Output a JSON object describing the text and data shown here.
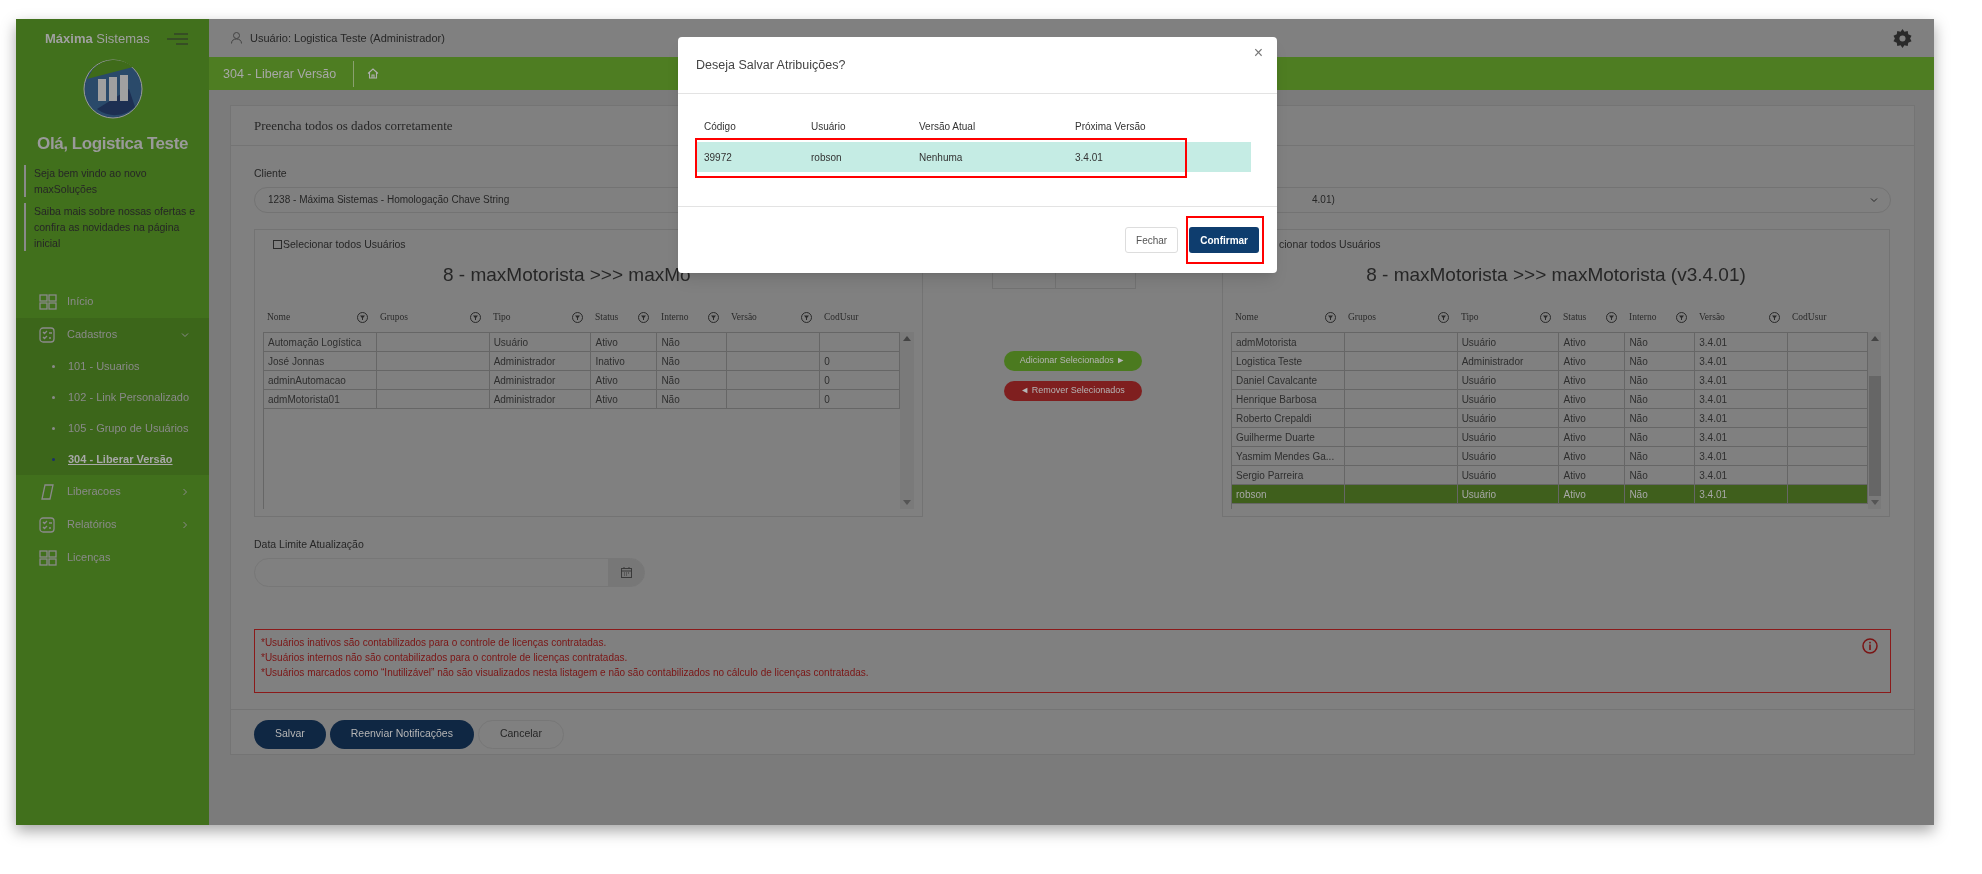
{
  "sidebar": {
    "brand": "**Máxima** Sistemas",
    "greeting": "Olá, Logistica Teste",
    "notes": [
      "Seja bem vindo ao novo maxSoluções",
      "Saiba mais sobre nossas ofertas e confira as novidades na página inicial"
    ],
    "menu": [
      {
        "kind": "link",
        "label": "Início"
      },
      {
        "kind": "group",
        "label": "Cadastros",
        "expanded": true,
        "children": [
          {
            "label": "101 - Usuarios",
            "selected": false
          },
          {
            "label": "102 - Link Personalizado",
            "selected": false
          },
          {
            "label": "105 - Grupo de Usuários",
            "selected": false
          },
          {
            "label": "304 - Liberar Versão",
            "selected": true
          }
        ]
      },
      {
        "kind": "group",
        "label": "Liberacoes",
        "expanded": false
      },
      {
        "kind": "group",
        "label": "Relatórios",
        "expanded": false
      },
      {
        "kind": "link",
        "label": "Licenças"
      }
    ]
  },
  "header": {
    "user": "Usuário: Logistica Teste (Administrador)"
  },
  "breadcrumb": "304 - Liberar Versão",
  "form": {
    "title": "Preencha todos os dados corretamente",
    "client_label": "Cliente",
    "client_value": "1238 - Máxima Sistemas - Homologação Chave String",
    "version_value": "4.01)",
    "left_panel": {
      "select_all": "Selecionar todos Usuários",
      "select_all_checked": false,
      "title": "8 - maxMotorista >>> maxMo",
      "columns": [
        "Nome",
        "Grupos",
        "Tipo",
        "Status",
        "Interno",
        "Versão",
        "CodUsur"
      ],
      "rows": [
        {
          "nome": "Automação Logística",
          "tipo": "Usuário",
          "status": "Ativo",
          "interno": "Não"
        },
        {
          "nome": "José Jonnas",
          "tipo": "Administrador",
          "status": "Inativo",
          "interno": "Não",
          "codusur": "0"
        },
        {
          "nome": "adminAutomacao",
          "tipo": "Administrador",
          "status": "Ativo",
          "interno": "Não",
          "codusur": "0"
        },
        {
          "nome": "admMotorista01",
          "tipo": "Administrador",
          "status": "Ativo",
          "interno": "Não",
          "codusur": "0"
        }
      ]
    },
    "middle": {
      "add": "Adicionar Selecionados ►",
      "remove": "◄ Remover Selecionados"
    },
    "right_panel": {
      "select_all": "cionar todos Usuários",
      "title": "8 - maxMotorista >>> maxMotorista (v3.4.01)",
      "columns": [
        "Nome",
        "Grupos",
        "Tipo",
        "Status",
        "Interno",
        "Versão",
        "CodUsur"
      ],
      "rows": [
        {
          "nome": "admMotorista",
          "tipo": "Usuário",
          "status": "Ativo",
          "interno": "Não",
          "versao": "3.4.01",
          "selected": false
        },
        {
          "nome": "Logistica Teste",
          "tipo": "Administrador",
          "status": "Ativo",
          "interno": "Não",
          "versao": "3.4.01",
          "selected": false
        },
        {
          "nome": "Daniel Cavalcante",
          "tipo": "Usuário",
          "status": "Ativo",
          "interno": "Não",
          "versao": "3.4.01",
          "selected": false
        },
        {
          "nome": "Henrique Barbosa",
          "tipo": "Usuário",
          "status": "Ativo",
          "interno": "Não",
          "versao": "3.4.01",
          "selected": false
        },
        {
          "nome": "Roberto Crepaldi",
          "tipo": "Usuário",
          "status": "Ativo",
          "interno": "Não",
          "versao": "3.4.01",
          "selected": false
        },
        {
          "nome": "Guilherme Duarte",
          "tipo": "Usuário",
          "status": "Ativo",
          "interno": "Não",
          "versao": "3.4.01",
          "selected": false
        },
        {
          "nome": "Yasmim Mendes Ga...",
          "tipo": "Usuário",
          "status": "Ativo",
          "interno": "Não",
          "versao": "3.4.01",
          "selected": false
        },
        {
          "nome": "Sergio Parreira",
          "tipo": "Usuário",
          "status": "Ativo",
          "interno": "Não",
          "versao": "3.4.01",
          "selected": false
        },
        {
          "nome": "robson",
          "tipo": "Usuário",
          "status": "Ativo",
          "interno": "Não",
          "versao": "3.4.01",
          "selected": true
        }
      ]
    },
    "date_label": "Data Limite Atualização",
    "notices": [
      "*Usuários inativos são contabilizados para o controle de licenças contratadas.",
      "*Usuários internos não são contabilizados para o controle de licenças contratadas.",
      "*Usuários marcados como “Inutilizável” não são visualizados nesta listagem e não são contabilizados no cálculo de licenças contratadas."
    ],
    "buttons": [
      {
        "kind": "primary",
        "label": "Salvar"
      },
      {
        "kind": "primary",
        "label": "Reenviar Notificações"
      },
      {
        "kind": "outline",
        "label": "Cancelar"
      }
    ]
  },
  "modal": {
    "title": "Deseja Salvar Atribuições?",
    "close": "×",
    "columns": [
      "Código",
      "Usuário",
      "Versão Atual",
      "Próxima Versão"
    ],
    "rows": [
      {
        "cells": [
          "39972",
          "robson",
          "Nenhuma",
          "3.4.01"
        ]
      }
    ],
    "buttons": [
      {
        "kind": "outline",
        "label": "Fechar"
      },
      {
        "kind": "primary",
        "label": "Confirmar"
      }
    ]
  }
}
